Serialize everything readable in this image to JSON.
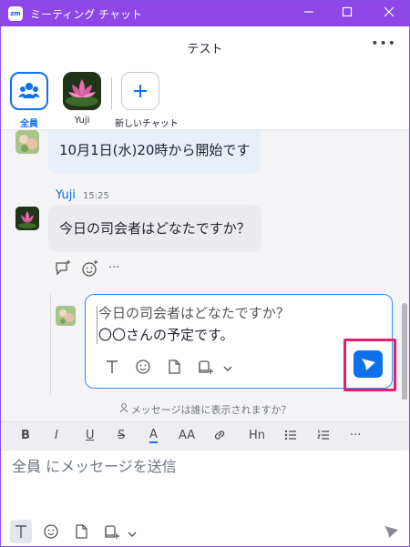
{
  "window": {
    "title": "ミーティング チャット",
    "logo": "zm",
    "buttons": [
      "minimize",
      "maximize",
      "close"
    ]
  },
  "header": {
    "title": "テスト",
    "more_label": "•••"
  },
  "channels": [
    {
      "label": "全員",
      "icon": "people-icon",
      "selected": true
    },
    {
      "label": "Yuji",
      "icon": "lotus-avatar",
      "selected": false
    },
    {
      "label": "新しいチャット",
      "icon": "plus-icon",
      "selected": false
    }
  ],
  "messages": [
    {
      "text": "10月1日(水)20時から開始です"
    },
    {
      "sender": "Yuji",
      "time": "15:25",
      "text": "今日の司会者はどなたですか？"
    }
  ],
  "reply_composer": {
    "lines": [
      "今日の司会者はどなたですか？",
      "〇〇さんの予定です。"
    ],
    "tools": [
      "text-format-icon",
      "emoji-icon",
      "file-icon",
      "screenshot-icon",
      "chevron-down-icon"
    ],
    "send_icon": "send-icon"
  },
  "visibility_prompt": "メッセージは誰に表示されますか？",
  "format_bar": {
    "bold": "B",
    "italic": "I",
    "underline": "U",
    "strike": "S",
    "font_color": "A",
    "font_size": "AA",
    "link": "link-icon",
    "heading": "Hn",
    "more": "···"
  },
  "main_input": {
    "placeholder": "全員 にメッセージを送信"
  },
  "colors": {
    "accent": "#8f46e6",
    "primary": "#0e71eb",
    "highlight": "#ee1c6e"
  }
}
